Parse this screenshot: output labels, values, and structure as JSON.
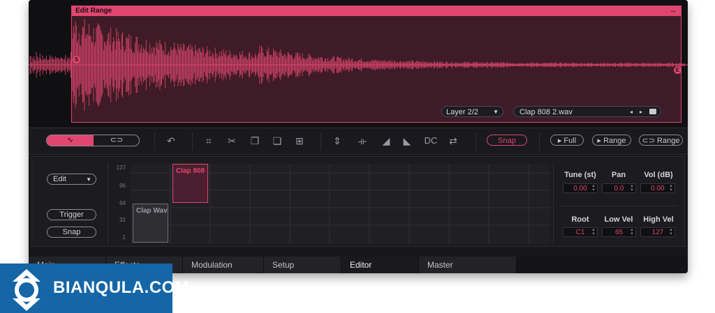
{
  "edit_range": {
    "title": "Edit Range",
    "start_marker": "S",
    "end_marker": "E",
    "expand_icon": "expand-horizontal-icon"
  },
  "wave_color": "#e0466f",
  "layer_select": {
    "value": "Layer 2/2"
  },
  "file_select": {
    "value": "Clap 808 2.wav"
  },
  "toolbar": {
    "dc_label": "DC",
    "snap_label": "Snap",
    "full_label": "▸ Full",
    "range_play_label": "▸ Range",
    "loop_range_label": "⊂⊃ Range"
  },
  "editor": {
    "edit_select": "Edit",
    "trigger_label": "Trigger",
    "snap_label": "Snap",
    "velocity_labels": [
      "127",
      "96",
      "64",
      "32",
      "1"
    ],
    "zones": [
      {
        "name": "Clap 808",
        "selected": true
      },
      {
        "name": "Clap Wav",
        "selected": false
      }
    ]
  },
  "params": {
    "tune_label": "Tune (st)",
    "tune_value": "0.00",
    "pan_label": "Pan",
    "pan_value": "0.0",
    "vol_label": "Vol (dB)",
    "vol_value": "0.00",
    "root_label": "Root",
    "root_value": "C1",
    "lowvel_label": "Low Vel",
    "lowvel_value": "65",
    "highvel_label": "High Vel",
    "highvel_value": "127"
  },
  "tabs": [
    "Main",
    "Effects",
    "Modulation",
    "Setup",
    "Editor",
    "Master"
  ],
  "active_tab": "Editor",
  "watermark": {
    "text": "BIANQULA.COM"
  },
  "accent_color": "#e0466f"
}
